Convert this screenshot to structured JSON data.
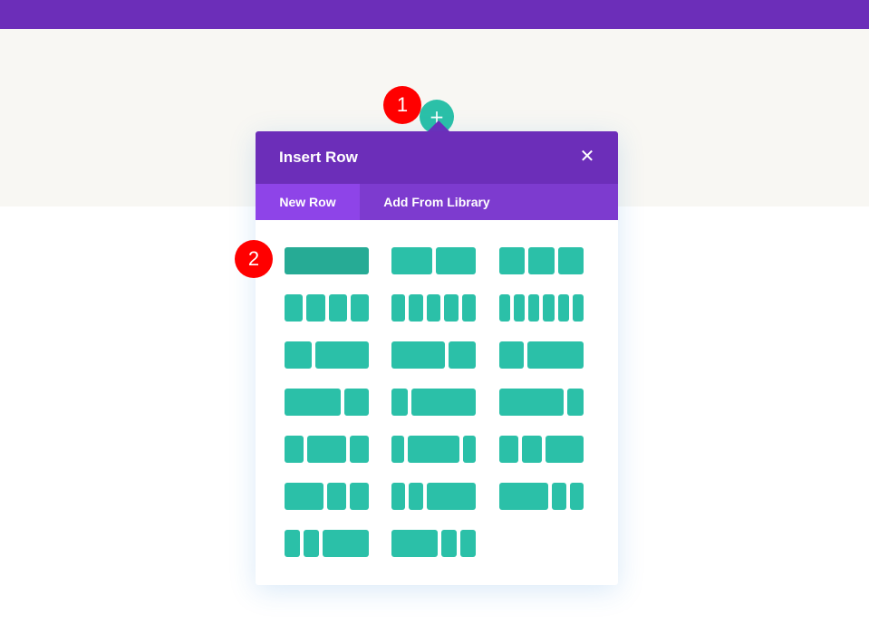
{
  "colors": {
    "topbar": "#6c2eb9",
    "section_background": "#f8f7f3",
    "modal_header": "#6c2eb9",
    "tab_bar": "#7d3bcf",
    "active_tab": "#8e44e8",
    "column_block": "#2bc0a8",
    "annotation_badge": "#ff0000"
  },
  "add_row_button": {
    "icon": "plus-icon",
    "symbol": "+"
  },
  "annotations": {
    "badge_1": "1",
    "badge_2": "2"
  },
  "modal": {
    "title": "Insert Row",
    "close_icon": "close-icon",
    "close_symbol": "✕",
    "tabs": [
      {
        "label": "New Row",
        "active": true
      },
      {
        "label": "Add From Library",
        "active": false
      }
    ]
  },
  "layouts": [
    {
      "columns": [
        1
      ],
      "selected": true
    },
    {
      "columns": [
        1,
        1
      ]
    },
    {
      "columns": [
        1,
        1,
        1
      ]
    },
    {
      "columns": [
        1,
        1,
        1,
        1
      ]
    },
    {
      "columns": [
        1,
        1,
        1,
        1,
        1
      ]
    },
    {
      "columns": [
        1,
        1,
        1,
        1,
        1,
        1
      ]
    },
    {
      "columns": [
        1,
        2
      ]
    },
    {
      "columns": [
        2,
        1
      ]
    },
    {
      "columns": [
        1,
        2.3
      ]
    },
    {
      "columns": [
        2.3,
        1
      ]
    },
    {
      "columns": [
        1,
        4
      ]
    },
    {
      "columns": [
        4,
        1
      ]
    },
    {
      "columns": [
        1,
        2,
        1
      ]
    },
    {
      "columns": [
        1,
        4,
        1
      ]
    },
    {
      "columns": [
        1,
        1,
        2
      ]
    },
    {
      "columns": [
        2,
        1,
        1
      ]
    },
    {
      "columns": [
        1,
        1,
        3.5
      ]
    },
    {
      "columns": [
        3.5,
        1,
        1
      ]
    },
    {
      "columns": [
        1,
        1,
        3
      ]
    },
    {
      "columns": [
        3,
        1,
        1
      ]
    }
  ]
}
